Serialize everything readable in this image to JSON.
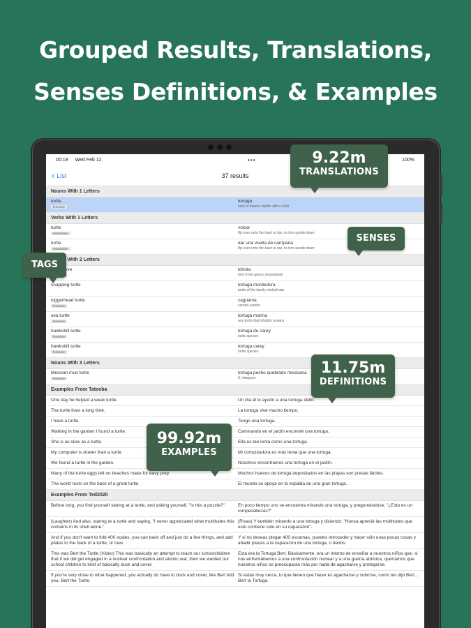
{
  "headline": {
    "line1": "Grouped Results, Translations,",
    "line2": "Senses Definitions, & Examples"
  },
  "status_bar": {
    "time": "00:18",
    "date": "Wed Feb 12",
    "battery": "100%"
  },
  "nav": {
    "back_label": "List",
    "title": "37 results"
  },
  "sections": [
    {
      "header": "Nouns With 1 Letters",
      "rows": [
        {
          "term": "turtle",
          "tag": "feminine",
          "translation": "tortuga",
          "definition": "land or marine reptile with a shell",
          "selected": true
        }
      ]
    },
    {
      "header": "Verbs With 1 Letters",
      "rows": [
        {
          "term": "turtle",
          "tag": "intransitive",
          "translation": "volcar",
          "definition": "flip over onto the back or top, to turn upside down"
        },
        {
          "term": "turtle",
          "tag": "intransitive",
          "translation": "dar una vuelta de campana",
          "definition": "flip over onto the back or top, to turn upside down"
        }
      ]
    },
    {
      "header": "Nouns With 2 Letters",
      "rows": [
        {
          "term": "turtle dove",
          "tag": "feminine",
          "translation": "tórtola",
          "definition": "bird in the genus streptopelia"
        },
        {
          "term": "snapping turtle",
          "tag": "",
          "translation": "tortuga mordedora",
          "definition": "turtle of the family chelydridae"
        },
        {
          "term": "loggerhead turtle",
          "tag": "feminine",
          "translation": "caguama",
          "definition": "caretta caretta"
        },
        {
          "term": "sea turtle",
          "tag": "feminine",
          "translation": "tortuga marina",
          "definition": "any turtle that inhabits oceans"
        },
        {
          "term": "hawksbill turtle",
          "tag": "feminine",
          "translation": "tortuga de carey",
          "definition": "turtle species"
        },
        {
          "term": "hawksbill turtle",
          "tag": "feminine",
          "translation": "tortuga carey",
          "definition": "turtle species"
        }
      ]
    },
    {
      "header": "Nouns With 3 Letters",
      "rows": [
        {
          "term": "Mexican mud turtle",
          "tag": "feminine",
          "translation": "tortuga pecho quebrado mexicana",
          "definition": "K. integrum"
        }
      ]
    }
  ],
  "examples_tatoeba": {
    "header": "Examples From Tatoeba",
    "rows": [
      {
        "en": "One day he helped a weak turtle.",
        "es": "Un día él le ayudó a una tortuga débil."
      },
      {
        "en": "The turtle lives a long time.",
        "es": "La tortuga vive mucho tiempo."
      },
      {
        "en": "I have a turtle.",
        "es": "Tengo una tortuga."
      },
      {
        "en": "Walking in the garden I found a turtle.",
        "es": "Caminando en el jardín encontré una tortuga."
      },
      {
        "en": "She is as slow as a turtle.",
        "es": "Ella es tan lenta como una tortuga."
      },
      {
        "en": "My computer is slower than a turtle.",
        "es": "Mi computadora es más lenta que una tortuga."
      },
      {
        "en": "We found a turtle in the garden.",
        "es": "Nosotros encontramos una tortuga en el jardín."
      },
      {
        "en": "Many of the turtle eggs left on beaches make for easy prey.",
        "es": "Muchos huevos de tortuga depositados en las playas son presas fáciles."
      },
      {
        "en": "The world rests on the back of a great turtle.",
        "es": "El mundo se apoya en la espalda de una gran tortuga."
      }
    ]
  },
  "examples_ted": {
    "header": "Examples From Ted2020",
    "rows": [
      {
        "en": "Before long, you find yourself staring at a turtle, and asking yourself, \"Is this a puzzle?\"",
        "es": "En poco tiempo uno se encuentra mirando una tortuga, y preguntándose, \"¿Esto es un rompecabezas?\""
      },
      {
        "en": "(Laughter) And also, staring at a turtle and saying, \"I never appreciated what multitudes this contains in its shell alone.\"",
        "es": "(Risas) Y también mirando a una tortuga y diciendo: \"Nunca aprecié las multitudes que esto contiene solo en su caparazón\"."
      },
      {
        "en": "And if you don't want to fold 400 scales, you can back off and just do a few things, and add plates to the back of a turtle, or toes.",
        "es": "Y si no deseas plegar 400 escamas, puedes retroceder y hacer sólo unas pocas cosas y añadir placas a la caparazón de una tortuga, o dedos."
      },
      {
        "en": "This was Bert the Turtle (Video) This was basically an attempt to teach our schoolchildren that if we did get engaged in a nuclear confrontation and atomic war, then we wanted our school children to kind of basically duck and cover.",
        "es": "Esta era la Tortuga Bert. Básicamente, era un intento de enseñar a nuestros niños que, si nos enfrentábamos a una confrontación nuclear y a una guerra atómica, queríamos que nuestros niños se preocuparan más por nada de agacharse y protegerse."
      },
      {
        "en": "If you're very close to what happened, you actually do have to duck and cover, like Bert told you, Bert the Turtle.",
        "es": "Si están muy cerca, lo que tienen que hacer es agacharse y cubrirse, como les dijo Bert... Bert la Tortuga."
      }
    ]
  },
  "callouts": {
    "translations": {
      "value": "9.22m",
      "label": "TRANSLATIONS"
    },
    "senses": {
      "label": "SENSES"
    },
    "tags": {
      "label": "TAGS"
    },
    "definitions": {
      "value": "11.75m",
      "label": "DEFINITIONS"
    },
    "examples": {
      "value": "99.92m",
      "label": "EXAMPLES"
    }
  },
  "colors": {
    "background": "#277459",
    "callout": "#40624a",
    "selected_row": "#bcd4f7",
    "link": "#2f7cf6"
  }
}
